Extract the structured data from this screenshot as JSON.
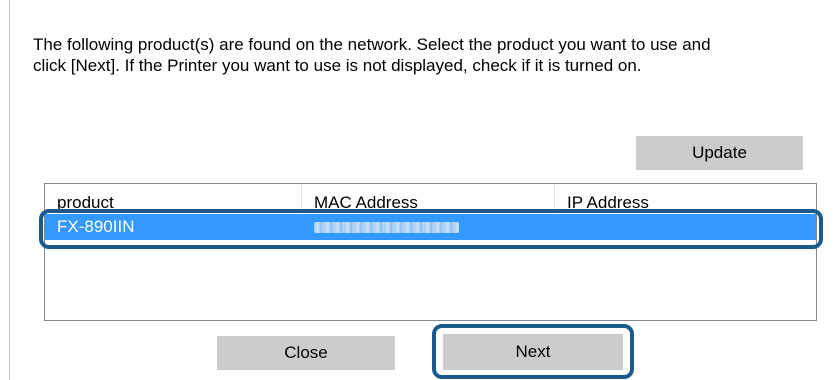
{
  "dialog": {
    "instructions_line1": "The following product(s) are found on the network. Select the product you want to use and",
    "instructions_line2": "click [Next]. If the Printer you want to use is not displayed, check if it is turned on.",
    "update_label": "Update",
    "close_label": "Close",
    "next_label": "Next"
  },
  "table": {
    "columns": [
      "product",
      "MAC Address",
      "IP Address"
    ],
    "rows": [
      {
        "product": "FX-890IIN",
        "mac": "",
        "ip": "",
        "selected": true
      }
    ]
  },
  "colors": {
    "selection": "#3399ff",
    "highlight_outline": "#1a5b8c",
    "button_bg": "#cccccc"
  }
}
